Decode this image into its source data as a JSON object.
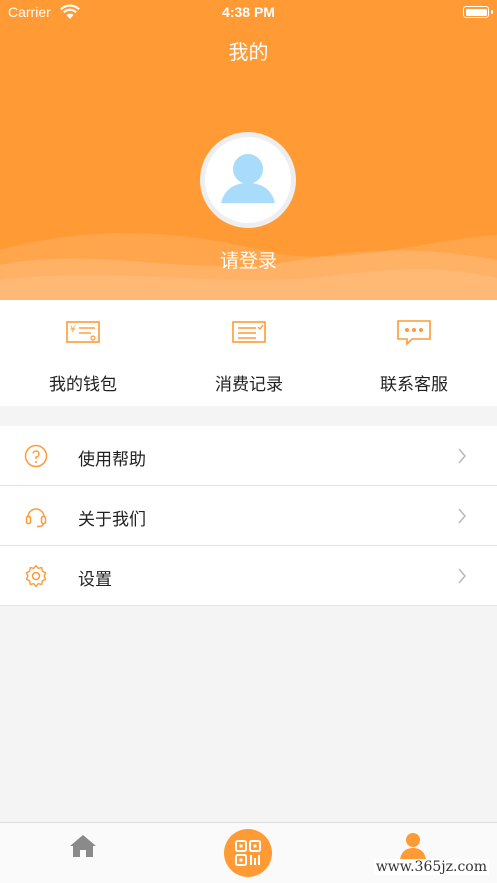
{
  "status_bar": {
    "carrier": "Carrier",
    "time": "4:38 PM"
  },
  "header": {
    "title": "我的",
    "login_prompt": "请登录",
    "accent_color": "#ff9a35"
  },
  "quick_actions": [
    {
      "label": "我的钱包",
      "icon": "wallet-icon"
    },
    {
      "label": "消费记录",
      "icon": "receipt-icon"
    },
    {
      "label": "联系客服",
      "icon": "chat-icon"
    }
  ],
  "menu": [
    {
      "label": "使用帮助",
      "icon": "help-icon"
    },
    {
      "label": "关于我们",
      "icon": "headset-icon"
    },
    {
      "label": "设置",
      "icon": "gear-icon"
    }
  ],
  "tabbar": {
    "items": [
      {
        "icon": "home-icon"
      },
      {
        "icon": "qr-code-icon"
      },
      {
        "icon": "profile-icon"
      }
    ]
  },
  "watermark": "www.365jz.com"
}
